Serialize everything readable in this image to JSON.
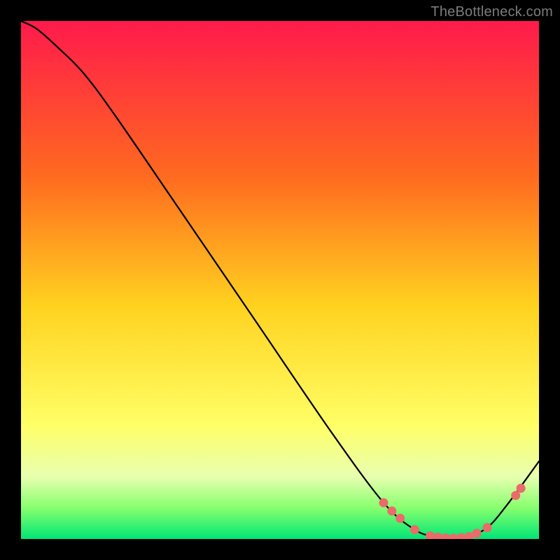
{
  "attribution": "TheBottleneck.com",
  "chart_data": {
    "type": "line",
    "title": "",
    "xlabel": "",
    "ylabel": "",
    "xlim": [
      0,
      100
    ],
    "ylim": [
      0,
      100
    ],
    "grid": false,
    "legend": false,
    "gradient_stops": [
      {
        "offset": 0,
        "color": "#ff1a4b"
      },
      {
        "offset": 30,
        "color": "#ff6a1f"
      },
      {
        "offset": 55,
        "color": "#ffd21f"
      },
      {
        "offset": 78,
        "color": "#ffff66"
      },
      {
        "offset": 88,
        "color": "#e8ffb0"
      },
      {
        "offset": 94,
        "color": "#87ff6e"
      },
      {
        "offset": 100,
        "color": "#00e676"
      }
    ],
    "series": [
      {
        "name": "curve",
        "color": "#000000",
        "width": 2.25,
        "x": [
          0,
          3,
          7,
          12,
          18,
          30,
          45,
          60,
          70,
          76,
          80,
          83,
          86,
          90,
          94,
          100
        ],
        "y": [
          100,
          98.5,
          95,
          90,
          82,
          64.5,
          42.5,
          20.5,
          7,
          1.8,
          0.4,
          0.15,
          0.4,
          2.2,
          6.8,
          15
        ]
      }
    ],
    "markers": {
      "color": "#ec6a6a",
      "radius": 6.5,
      "points": [
        {
          "x": 70.0,
          "y": 7.0
        },
        {
          "x": 71.6,
          "y": 5.4
        },
        {
          "x": 73.2,
          "y": 4.0
        },
        {
          "x": 76.0,
          "y": 1.8
        },
        {
          "x": 79.0,
          "y": 0.6
        },
        {
          "x": 80.5,
          "y": 0.35
        },
        {
          "x": 82.0,
          "y": 0.2
        },
        {
          "x": 83.5,
          "y": 0.15
        },
        {
          "x": 85.0,
          "y": 0.25
        },
        {
          "x": 86.5,
          "y": 0.45
        },
        {
          "x": 88.0,
          "y": 1.1
        },
        {
          "x": 90.0,
          "y": 2.2
        },
        {
          "x": 95.5,
          "y": 8.4
        },
        {
          "x": 96.5,
          "y": 9.8
        }
      ]
    }
  }
}
